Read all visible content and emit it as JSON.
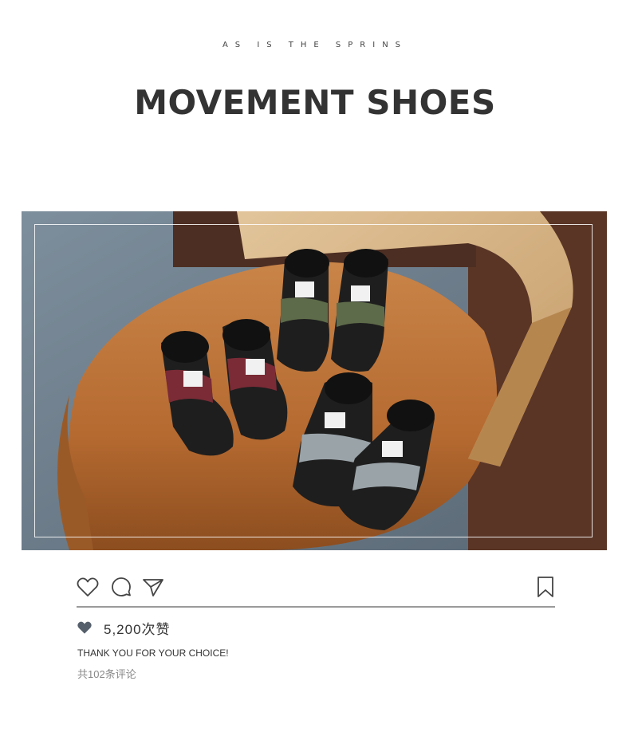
{
  "header": {
    "tagline": "AS IS THE SPRINS",
    "title": "MOVEMENT SHOES"
  },
  "photo": {
    "alt": "Kids camouflage snow boots on a leather chair"
  },
  "actions": {
    "like_icon": "heart-outline-icon",
    "comment_icon": "comment-bubble-icon",
    "share_icon": "paper-plane-icon",
    "save_icon": "bookmark-icon"
  },
  "post": {
    "likes_text": "5,200次赞",
    "caption": "THANK YOU FOR YOUR CHOICE!",
    "comments_text": "共102条评论"
  },
  "colors": {
    "heart_fill": "#555f6b",
    "divider": "#9a9a9a",
    "title": "#333333"
  }
}
